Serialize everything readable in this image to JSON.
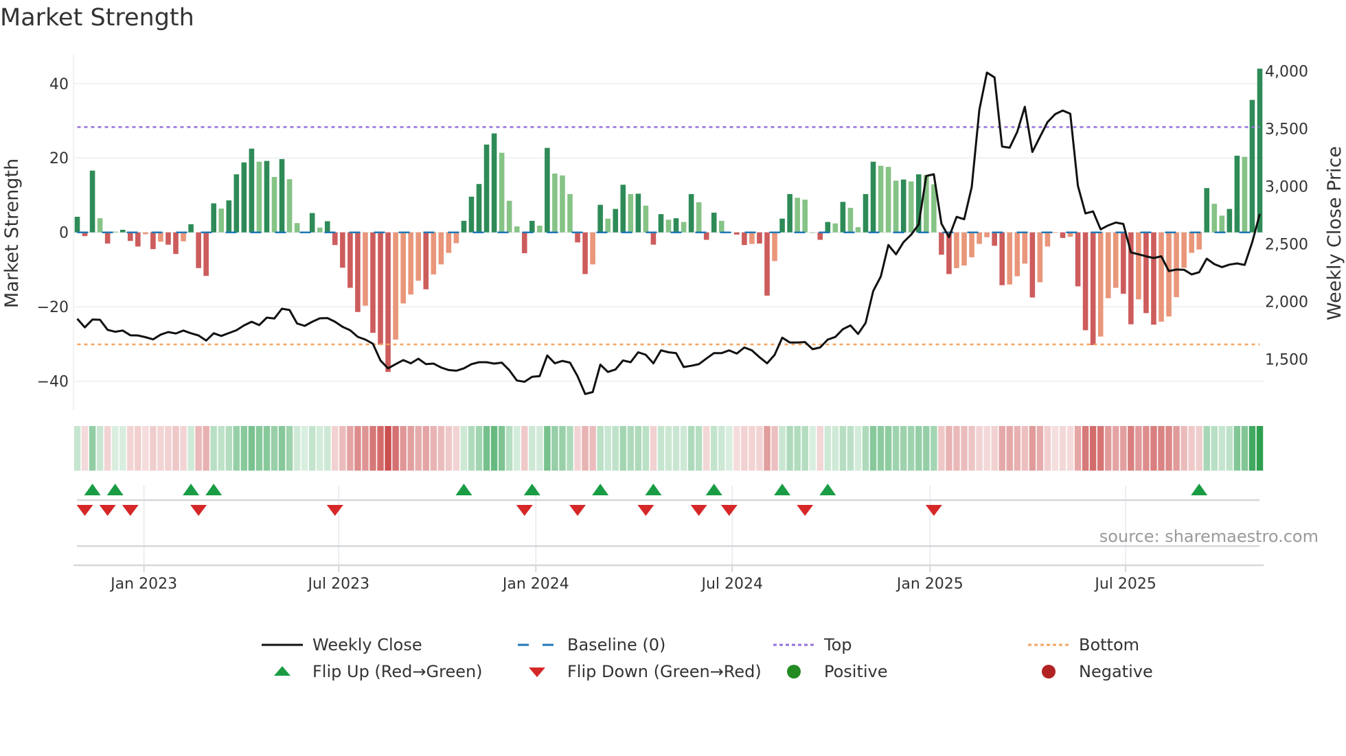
{
  "title": "Market Strength",
  "source": "source: sharemaestro.com",
  "colors": {
    "pos_strong": "#2e8b57",
    "pos_weak": "#86c386",
    "neg_strong": "#cd5c5c",
    "neg_weak": "#e9967a",
    "line": "#111111",
    "baseline": "#1f77b4",
    "top": "#9370db",
    "bottom": "#f4a460",
    "flip_up": "#1a9c45",
    "flip_down": "#d62728",
    "positive": "#228b22",
    "negative": "#b22222"
  },
  "legend": [
    {
      "label": "Weekly Close",
      "icon": "solid-line"
    },
    {
      "label": "Baseline (0)",
      "icon": "dashed-line"
    },
    {
      "label": "Top",
      "icon": "dotted-line-purple"
    },
    {
      "label": "Bottom",
      "icon": "dotted-line-orange"
    },
    {
      "label": "Flip Up (Red→Green)",
      "icon": "triangle-up"
    },
    {
      "label": "Flip Down (Green→Red)",
      "icon": "triangle-down"
    },
    {
      "label": "Positive",
      "icon": "circle-green"
    },
    {
      "label": "Negative",
      "icon": "circle-red"
    }
  ],
  "chart_data": {
    "type": "bar+line",
    "title": "Market Strength",
    "left_axis": {
      "label": "Market Strength",
      "range": [
        -47.8,
        47.7
      ],
      "ticks": [
        40,
        20,
        0,
        -20,
        -40
      ],
      "tick_labels": [
        "40",
        "20",
        "0",
        "−20",
        "−40"
      ]
    },
    "right_axis": {
      "label": "Weekly Close Price",
      "range": [
        1030,
        4250
      ],
      "ticks": [
        4000,
        3500,
        3000,
        2500,
        2000,
        1500
      ],
      "tick_labels": [
        "4,000",
        "3,500",
        "3,000",
        "2,500",
        "2,000",
        "1,500"
      ]
    },
    "x_ticks": [
      {
        "label": "Jan 2023",
        "week": 8.8
      },
      {
        "label": "Jul 2023",
        "week": 34.5
      },
      {
        "label": "Jan 2024",
        "week": 60.5
      },
      {
        "label": "Jul 2024",
        "week": 86.4
      },
      {
        "label": "Jan 2025",
        "week": 112.5
      },
      {
        "label": "Jul 2025",
        "week": 138.3
      }
    ],
    "reference_lines": {
      "baseline": 0,
      "top": 28.3,
      "bottom": -30.1
    },
    "strength": [
      4.2,
      -1,
      16.6,
      3.8,
      -3,
      0.2,
      0.7,
      -2.3,
      -3.8,
      -0.5,
      -4.5,
      -2.5,
      -3.3,
      -5.8,
      -2.4,
      2.2,
      -9.6,
      -11.7,
      7.8,
      6.4,
      8.6,
      15.6,
      18.8,
      22.5,
      19,
      19.2,
      14.9,
      19.7,
      14.3,
      2.5,
      0.2,
      5.2,
      1.3,
      3,
      -3.4,
      -9.5,
      -14.9,
      -21.4,
      -19.7,
      -27,
      -30.2,
      -37.5,
      -28.8,
      -19.1,
      -16.7,
      -13,
      -15.3,
      -11.3,
      -8.6,
      -5.5,
      -2.9,
      3.1,
      9.6,
      13,
      23.6,
      26.6,
      21.4,
      8.5,
      1.6,
      -5.6,
      3.1,
      1.8,
      22.7,
      15.8,
      15.3,
      10.3,
      -2.7,
      -11.2,
      -8.6,
      7.4,
      3.7,
      6.3,
      12.8,
      10.3,
      10.4,
      7.2,
      -3.3,
      4.9,
      3.4,
      3.8,
      2.8,
      10.3,
      8.1,
      -2,
      5.3,
      3.1,
      0,
      -0.6,
      -3.4,
      -3.1,
      -3,
      -17,
      -7.7,
      3.7,
      10.3,
      9.3,
      8.8,
      0,
      -2,
      2.8,
      2.4,
      8.2,
      6.6,
      1.4,
      10.3,
      19,
      17.9,
      17.6,
      13.9,
      14.2,
      13.7,
      15.6,
      15.4,
      12.9,
      -6,
      -11.2,
      -9.6,
      -8.9,
      -6.7,
      -3.1,
      -1.3,
      -3.6,
      -14.2,
      -14,
      -11.8,
      -8.4,
      -17.5,
      -13.4,
      -3.8,
      -0.1,
      -1.5,
      -1.2,
      -14.5,
      -26.3,
      -30.3,
      -28,
      -17.7,
      -14.9,
      -16.5,
      -24.7,
      -18,
      -21.7,
      -24.8,
      -24,
      -22.6,
      -17.4,
      -9.5,
      -5.5,
      -4.6,
      11.9,
      7.7,
      4.5,
      6.3,
      20.6,
      20.3,
      35.6,
      44
    ],
    "strong": [
      1,
      1,
      1,
      0,
      1,
      0,
      1,
      1,
      1,
      0,
      1,
      0,
      1,
      1,
      0,
      1,
      1,
      1,
      1,
      0,
      1,
      1,
      1,
      1,
      0,
      1,
      0,
      1,
      0,
      0,
      0,
      1,
      0,
      1,
      1,
      1,
      1,
      1,
      0,
      1,
      1,
      1,
      0,
      0,
      0,
      0,
      1,
      0,
      0,
      0,
      0,
      1,
      1,
      1,
      1,
      1,
      0,
      0,
      0,
      1,
      1,
      0,
      1,
      0,
      0,
      0,
      1,
      1,
      0,
      1,
      0,
      1,
      1,
      0,
      1,
      0,
      1,
      1,
      0,
      1,
      0,
      1,
      0,
      1,
      1,
      0,
      0,
      1,
      1,
      0,
      1,
      1,
      0,
      1,
      1,
      0,
      0,
      0,
      1,
      1,
      0,
      1,
      0,
      0,
      1,
      1,
      0,
      0,
      0,
      1,
      0,
      1,
      0,
      0,
      1,
      1,
      0,
      0,
      0,
      0,
      0,
      1,
      1,
      0,
      0,
      0,
      1,
      0,
      0,
      0,
      1,
      0,
      1,
      1,
      1,
      0,
      0,
      0,
      1,
      1,
      0,
      1,
      1,
      0,
      0,
      0,
      0,
      0,
      0,
      1,
      0,
      0,
      1,
      1,
      0,
      1,
      1
    ],
    "weekly_close": [
      1851,
      1776,
      1844,
      1842,
      1755,
      1738,
      1749,
      1708,
      1706,
      1691,
      1672,
      1713,
      1736,
      1723,
      1749,
      1725,
      1706,
      1662,
      1725,
      1702,
      1727,
      1751,
      1793,
      1825,
      1796,
      1861,
      1853,
      1938,
      1927,
      1810,
      1789,
      1825,
      1855,
      1857,
      1825,
      1781,
      1751,
      1694,
      1670,
      1634,
      1489,
      1421,
      1457,
      1492,
      1464,
      1504,
      1457,
      1462,
      1428,
      1406,
      1400,
      1421,
      1457,
      1474,
      1474,
      1462,
      1470,
      1404,
      1315,
      1304,
      1347,
      1353,
      1532,
      1464,
      1485,
      1470,
      1353,
      1198,
      1215,
      1453,
      1389,
      1411,
      1489,
      1474,
      1560,
      1538,
      1464,
      1577,
      1560,
      1553,
      1432,
      1443,
      1457,
      1506,
      1553,
      1553,
      1577,
      1549,
      1602,
      1577,
      1517,
      1464,
      1538,
      1687,
      1645,
      1645,
      1649,
      1587,
      1602,
      1670,
      1693,
      1761,
      1793,
      1719,
      1815,
      2091,
      2218,
      2491,
      2410,
      2516,
      2580,
      2669,
      3090,
      3105,
      2676,
      2559,
      2735,
      2714,
      2994,
      3664,
      3987,
      3945,
      3345,
      3335,
      3473,
      3690,
      3298,
      3430,
      3558,
      3626,
      3658,
      3630,
      3005,
      2765,
      2782,
      2627,
      2661,
      2686,
      2673,
      2427,
      2410,
      2393,
      2378,
      2393,
      2265,
      2278,
      2276,
      2236,
      2255,
      2372,
      2325,
      2299,
      2321,
      2331,
      2318,
      2516,
      2761
    ],
    "flips_up_weeks": [
      2,
      5,
      15,
      18,
      51,
      60,
      69,
      76,
      84,
      93,
      99,
      148
    ],
    "flips_down_weeks": [
      1,
      4,
      7,
      16,
      34,
      59,
      66,
      75,
      82,
      86,
      96,
      113
    ],
    "legend_position": "bottom"
  }
}
